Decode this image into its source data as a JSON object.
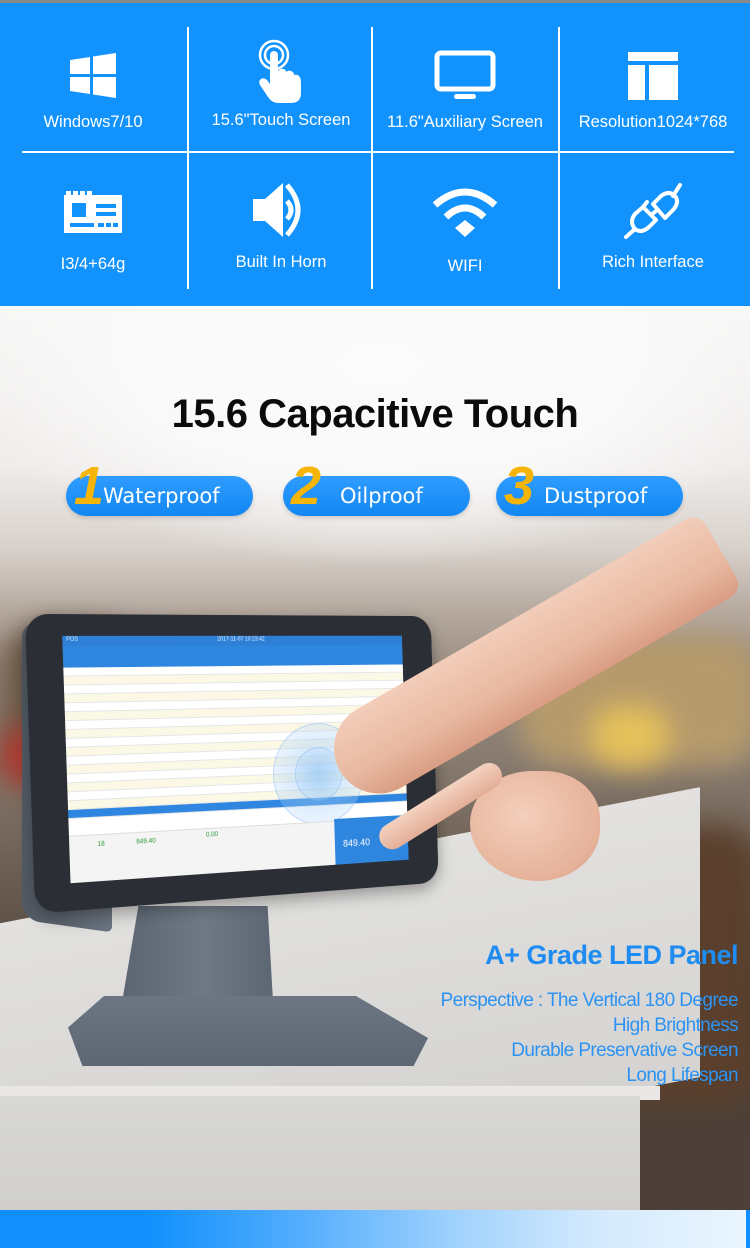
{
  "features": [
    {
      "icon": "windows-logo-icon",
      "label": "Windows7/10"
    },
    {
      "icon": "touch-hand-icon",
      "label": "15.6\"Touch Screen"
    },
    {
      "icon": "monitor-icon",
      "label": "11.6\"Auxiliary Screen"
    },
    {
      "icon": "layout-icon",
      "label": "Resolution1024*768"
    },
    {
      "icon": "motherboard-icon",
      "label": "I3/4+64g"
    },
    {
      "icon": "speaker-icon",
      "label": "Built In Horn"
    },
    {
      "icon": "wifi-icon",
      "label": "WIFI"
    },
    {
      "icon": "plug-icon",
      "label": "Rich Interface"
    }
  ],
  "headline": "15.6 Capacitive Touch",
  "badges": [
    {
      "number": "1",
      "label": "Waterproof"
    },
    {
      "number": "2",
      "label": "Oilproof"
    },
    {
      "number": "3",
      "label": "Dustproof"
    }
  ],
  "pos_screen": {
    "brand": "POS",
    "clock": "2017-11-07 10:23:42",
    "item_count": "18",
    "total": "849.40",
    "discount": "0.00",
    "pay_amount": "849.40"
  },
  "panel": {
    "title": "A+ Grade LED Panel",
    "lines": [
      "Perspective : The Vertical 180 Degree",
      "High Brightness",
      "Durable Preservative Screen",
      "Long Lifespan"
    ]
  },
  "colors": {
    "brand_blue": "#1192fd",
    "badge_number": "#f6b404",
    "panel_text": "#1e8cf0"
  }
}
